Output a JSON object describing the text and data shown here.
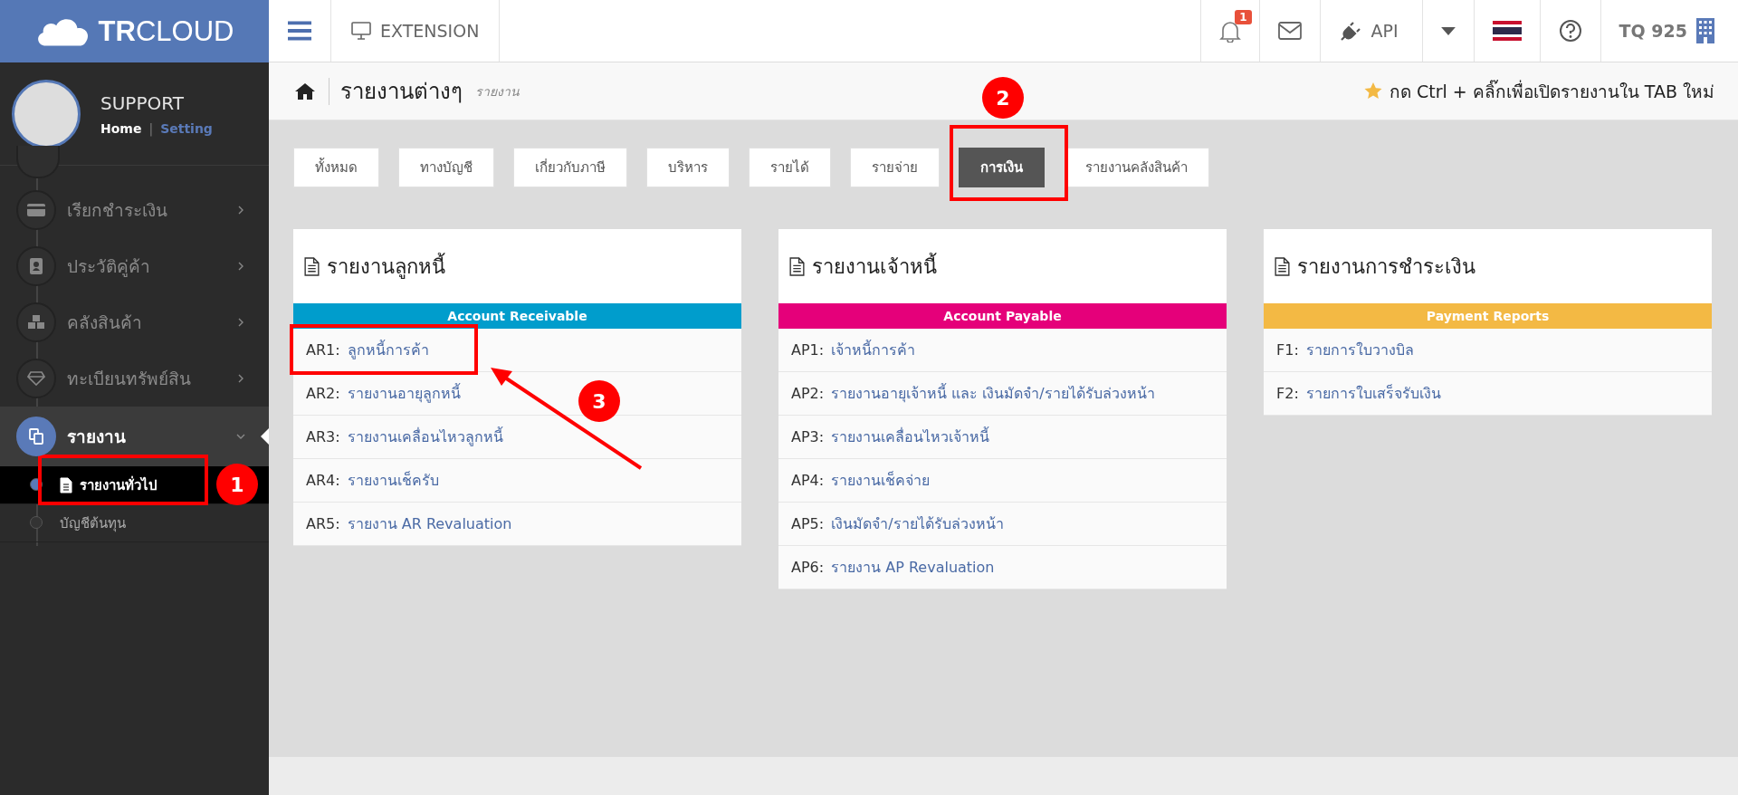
{
  "topbar": {
    "logo": "TRCLOUD",
    "extension": "EXTENSION",
    "notification_count": "1",
    "api": "API",
    "company": "TQ 925"
  },
  "user": {
    "name": "SUPPORT",
    "separator": "|",
    "links": [
      {
        "label": "Home",
        "selected": true
      },
      {
        "label": "Setting",
        "selected": false
      }
    ]
  },
  "sidebar": {
    "items": [
      {
        "label": "เรียกชำระเงิน",
        "expanded": false
      },
      {
        "label": "ประวัติคู่ค้า",
        "expanded": false
      },
      {
        "label": "คลังสินค้า",
        "expanded": false
      },
      {
        "label": "ทะเบียนทรัพย์สิน",
        "expanded": false
      },
      {
        "label": "รายงาน",
        "expanded": true,
        "children": [
          {
            "label": "รายงานทั่วไป",
            "selected": true
          },
          {
            "label": "บัญชีต้นทุน",
            "selected": false
          }
        ]
      }
    ]
  },
  "breadcrumb": {
    "title": "รายงานต่างๆ",
    "subtitle": "รายงาน"
  },
  "hint": "กด Ctrl + คลิ๊กเพื่อเปิดรายงานใน TAB ใหม่",
  "tabs": [
    {
      "label": "ทั้งหมด",
      "selected": false
    },
    {
      "label": "ทางบัญชี",
      "selected": false
    },
    {
      "label": "เกี่ยวกับภาษี",
      "selected": false
    },
    {
      "label": "บริหาร",
      "selected": false
    },
    {
      "label": "รายได้",
      "selected": false
    },
    {
      "label": "รายจ่าย",
      "selected": false
    },
    {
      "label": "การเงิน",
      "selected": true
    },
    {
      "label": "รายงานคลังสินค้า",
      "selected": false
    }
  ],
  "cards": [
    {
      "title": "รายงานลูกหนี้",
      "band": "Account Receivable",
      "color": "#009dcc",
      "rows": [
        {
          "code": "AR1:",
          "label": "ลูกหนี้การค้า"
        },
        {
          "code": "AR2:",
          "label": "รายงานอายุลูกหนี้"
        },
        {
          "code": "AR3:",
          "label": "รายงานเคลื่อนไหวลูกหนี้"
        },
        {
          "code": "AR4:",
          "label": "รายงานเช็ครับ"
        },
        {
          "code": "AR5:",
          "label": "รายงาน AR Revaluation"
        }
      ]
    },
    {
      "title": "รายงานเจ้าหนี้",
      "band": "Account Payable",
      "color": "#e5007a",
      "rows": [
        {
          "code": "AP1:",
          "label": "เจ้าหนี้การค้า"
        },
        {
          "code": "AP2:",
          "label": "รายงานอายุเจ้าหนี้ และ เงินมัดจำ/รายได้รับล่วงหน้า"
        },
        {
          "code": "AP3:",
          "label": "รายงานเคลื่อนไหวเจ้าหนี้"
        },
        {
          "code": "AP4:",
          "label": "รายงานเช็คจ่าย"
        },
        {
          "code": "AP5:",
          "label": "เงินมัดจำ/รายได้รับล่วงหน้า"
        },
        {
          "code": "AP6:",
          "label": "รายงาน AP Revaluation"
        }
      ]
    },
    {
      "title": "รายงานการชำระเงิน",
      "band": "Payment Reports",
      "color": "#f3b944",
      "rows": [
        {
          "code": "F1:",
          "label": "รายการใบวางบิล"
        },
        {
          "code": "F2:",
          "label": "รายการใบเสร็จรับเงิน"
        }
      ]
    }
  ],
  "annotations": [
    {
      "number": "1"
    },
    {
      "number": "2"
    },
    {
      "number": "3"
    }
  ]
}
